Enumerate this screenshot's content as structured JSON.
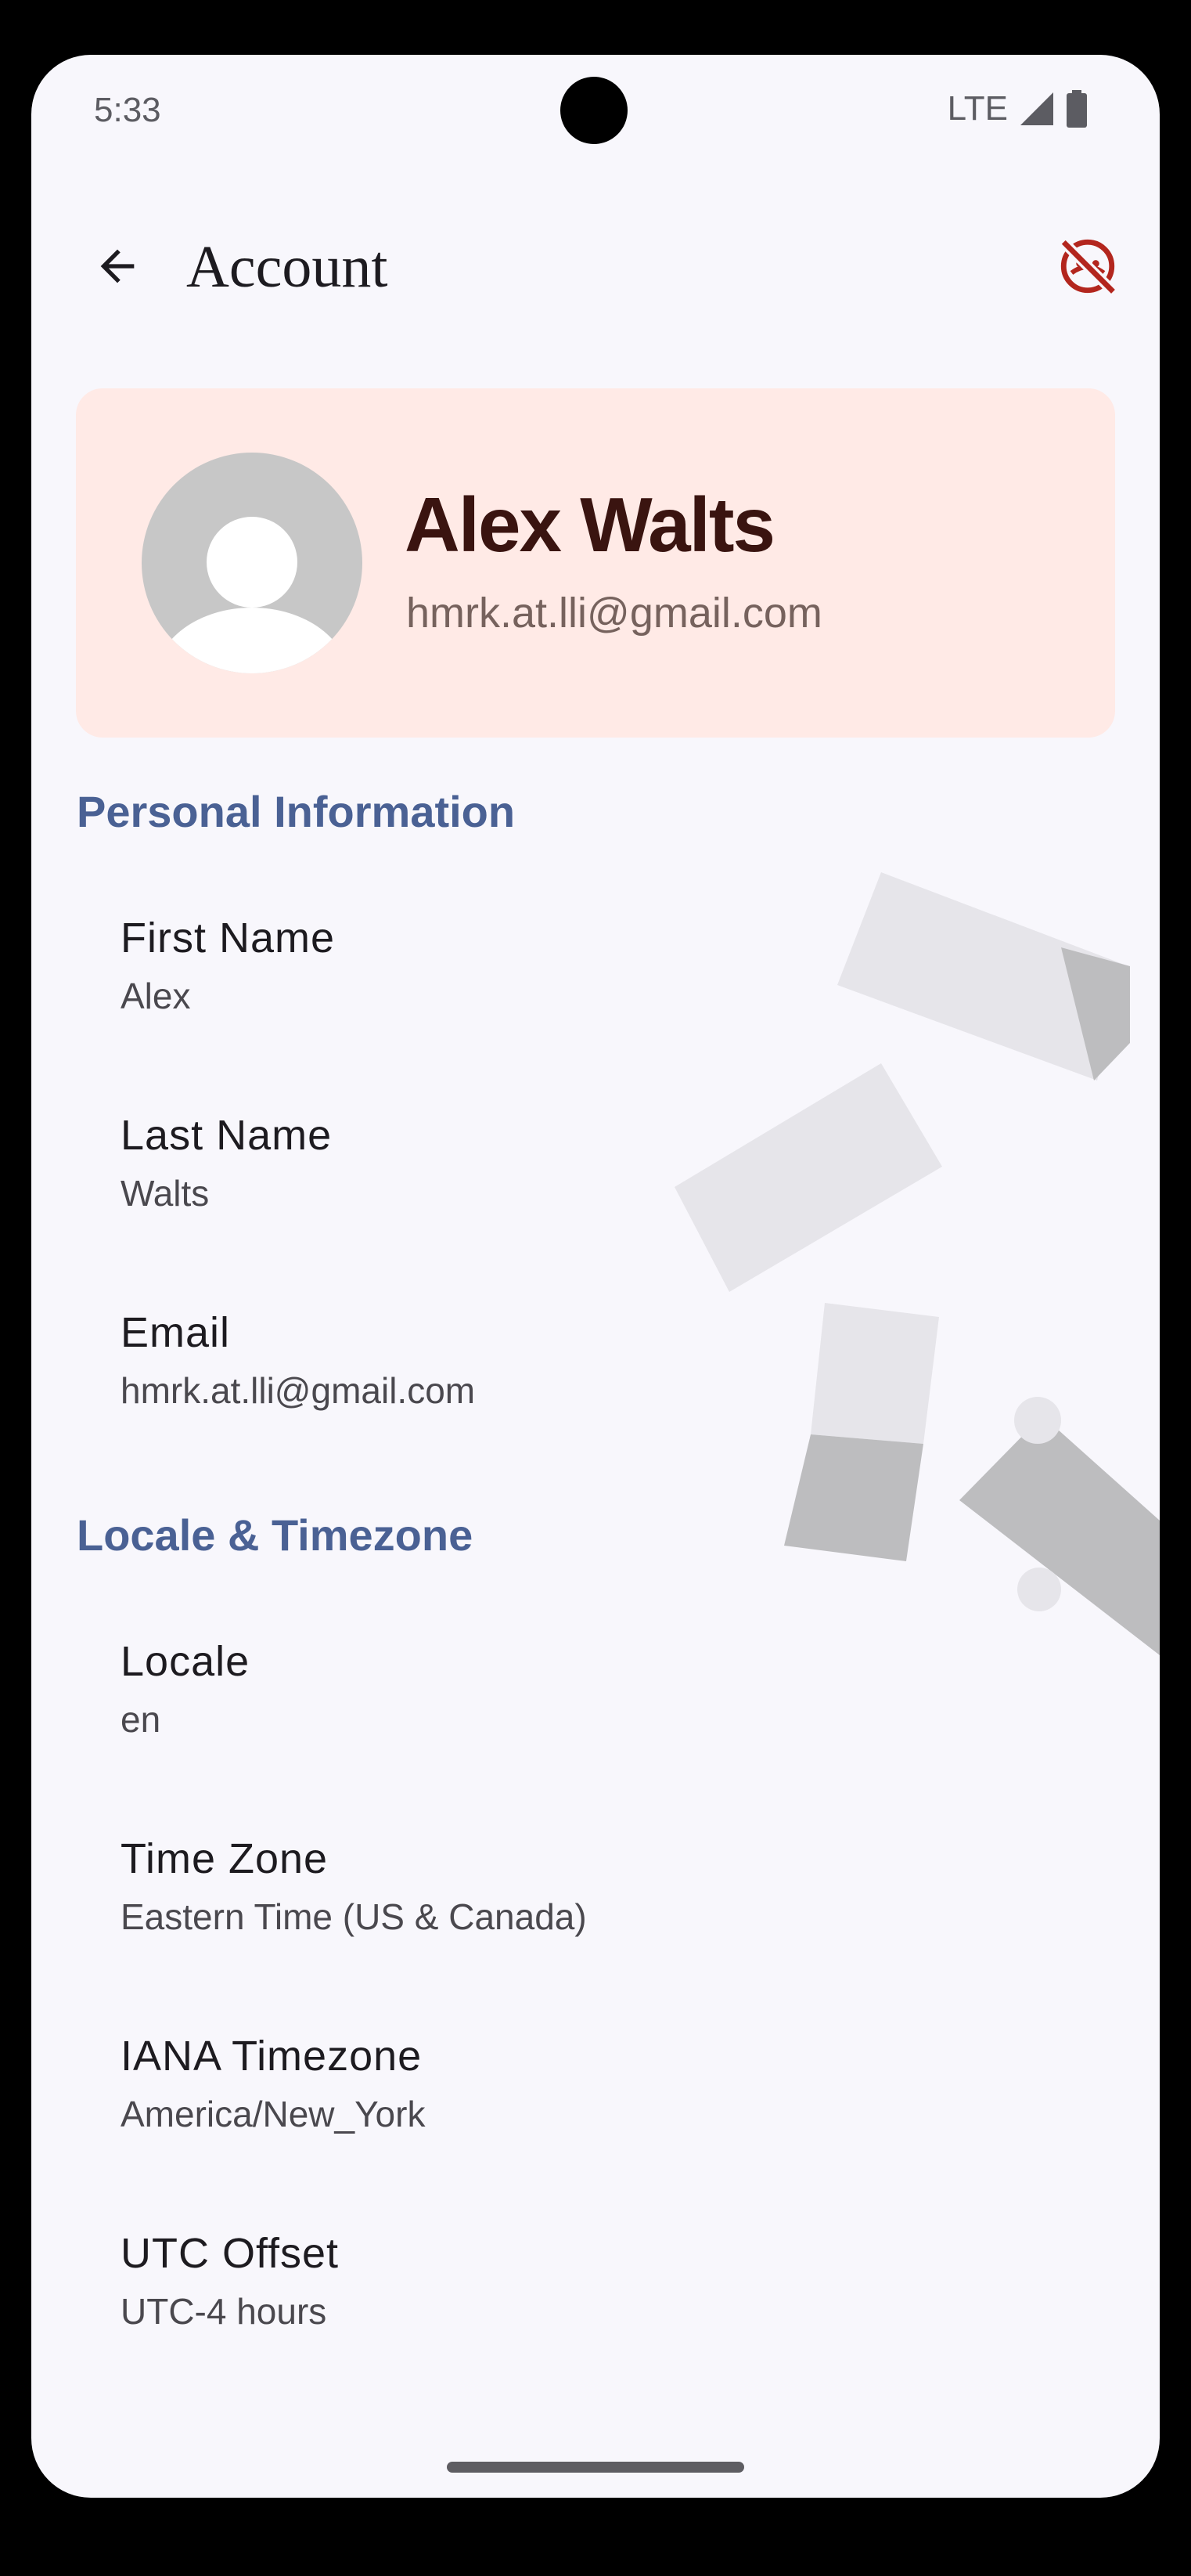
{
  "status_bar": {
    "time": "5:33",
    "network": "LTE",
    "icons": [
      "signal-icon",
      "battery-icon"
    ]
  },
  "app_bar": {
    "title": "Account",
    "back_icon": "arrow-back-icon",
    "action_icon": "face-off-icon",
    "action_color": "#b3261e"
  },
  "profile": {
    "name": "Alex Walts",
    "email": "hmrk.at.lli@gmail.com",
    "avatar_icon": "person-placeholder-icon",
    "card_color": "#ffeae6"
  },
  "sections": {
    "personal": {
      "title": "Personal Information",
      "fields": [
        {
          "label": "First Name",
          "value": "Alex"
        },
        {
          "label": "Last Name",
          "value": "Walts"
        },
        {
          "label": "Email",
          "value": "hmrk.at.lli@gmail.com"
        }
      ]
    },
    "locale": {
      "title": "Locale & Timezone",
      "fields": [
        {
          "label": "Locale",
          "value": "en"
        },
        {
          "label": "Time Zone",
          "value": "Eastern Time (US & Canada)"
        },
        {
          "label": "IANA Timezone",
          "value": "America/New_York"
        },
        {
          "label": "UTC Offset",
          "value": "UTC-4 hours"
        }
      ]
    }
  },
  "colors": {
    "section_title": "#4a6194",
    "background": "#f8f7fc"
  }
}
